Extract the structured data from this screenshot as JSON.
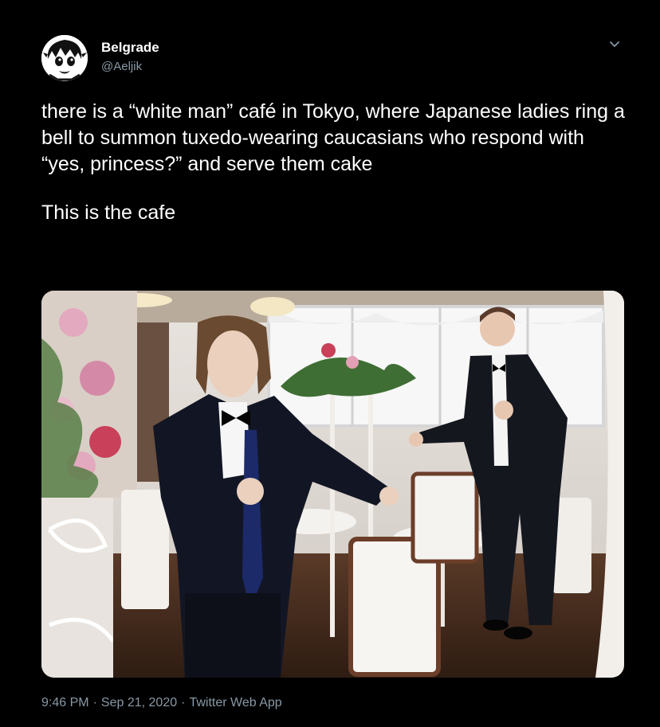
{
  "tweet": {
    "author": {
      "display_name": "Belgrade",
      "handle": "@Aeljik",
      "avatar_icon": "anime-avatar-icon"
    },
    "menu_icon": "chevron-down-icon",
    "text_paragraphs": [
      "there is a “white man” café in Tokyo, where Japanese ladies ring a bell to summon tuxedo-wearing caucasians who respond with “yes, princess?” and serve them cake",
      "This is the cafe"
    ],
    "media": {
      "type": "photo"
    },
    "time": "9:46 PM",
    "date": "Sep 21, 2020",
    "separator": "·",
    "source": "Twitter Web App"
  },
  "colors": {
    "background": "#000000",
    "text": "#ffffff",
    "secondary_text": "#8899a6"
  }
}
